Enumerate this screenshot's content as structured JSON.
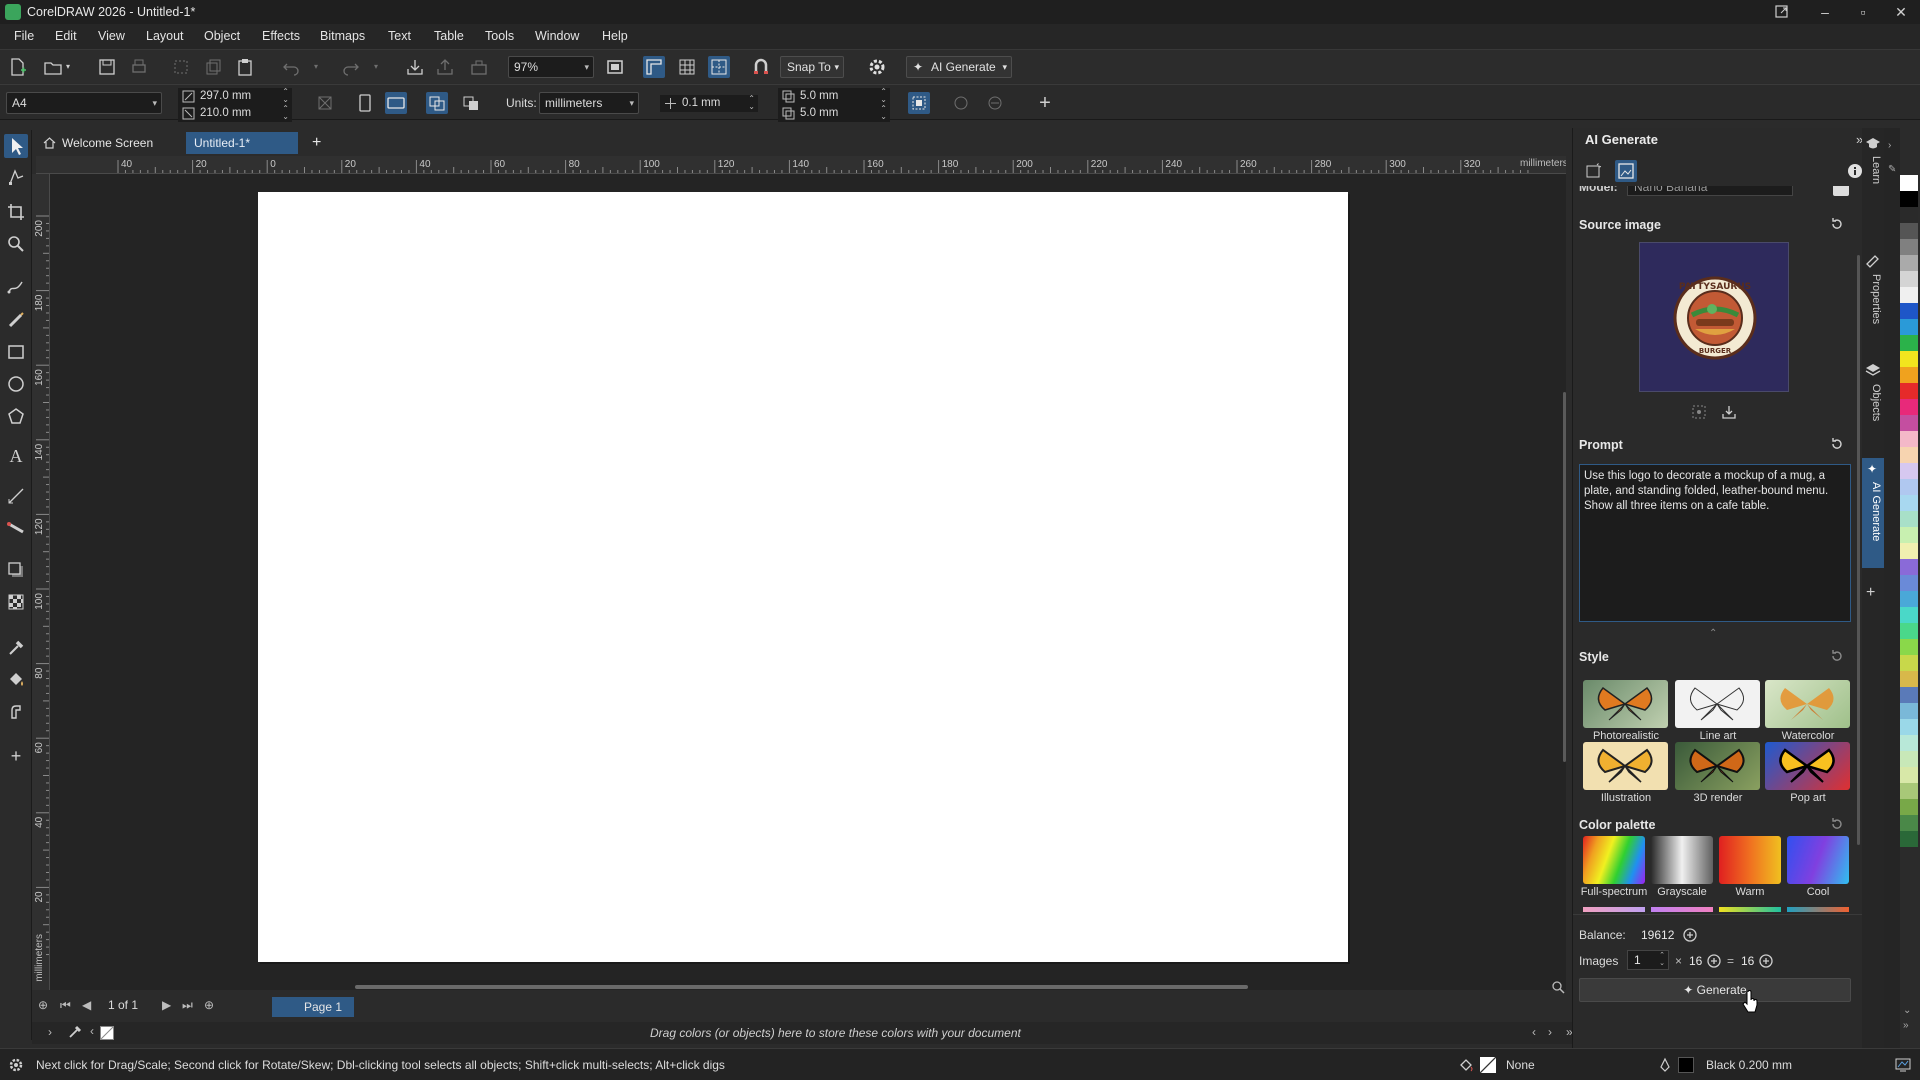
{
  "app": {
    "title": "CorelDRAW 2026 - Untitled-1*",
    "window_controls": [
      "minimize",
      "restore",
      "close"
    ]
  },
  "menu": [
    "File",
    "Edit",
    "View",
    "Layout",
    "Object",
    "Effects",
    "Bitmaps",
    "Text",
    "Table",
    "Tools",
    "Window",
    "Help"
  ],
  "toolbar": {
    "zoom": "97%",
    "snap_to": "Snap To",
    "ai_generate": "AI Generate"
  },
  "property_bar": {
    "page_size": "A4",
    "width": "297.0 mm",
    "height": "210.0 mm",
    "units_label": "Units:",
    "units": "millimeters",
    "nudge": "0.1 mm",
    "dup_x": "5.0 mm",
    "dup_y": "5.0 mm"
  },
  "tabs": {
    "welcome": "Welcome Screen",
    "doc": "Untitled-1*"
  },
  "rulers": {
    "h_labels": [
      "40",
      "20",
      "0",
      "20",
      "40",
      "60",
      "80",
      "100",
      "120",
      "140",
      "160",
      "180",
      "200",
      "220",
      "240",
      "260",
      "280",
      "300",
      "320"
    ],
    "h_units": "millimeters",
    "v_labels": [
      "200",
      "180",
      "160",
      "140",
      "120",
      "100",
      "80",
      "60",
      "40",
      "20"
    ],
    "v_units": "millimeters"
  },
  "page_nav": {
    "counter": "1 of 1",
    "page_tab": "Page 1"
  },
  "color_bar": {
    "hint": "Drag colors (or objects) here to store these colors with your document"
  },
  "status": {
    "message": "Next click for Drag/Scale; Second click for Rotate/Skew; Dbl-clicking tool selects all objects; Shift+click multi-selects; Alt+click digs",
    "fill": "None",
    "outline": "Black 0.200 mm"
  },
  "ai_panel": {
    "title": "AI Generate",
    "model_label": "Model:",
    "model_value": "Nano Banana",
    "source_image_title": "Source image",
    "logo_text_top": "PATTYSAURUS",
    "logo_text_bottom": "BURGER",
    "prompt_title": "Prompt",
    "prompt_text": "Use this logo to decorate a mockup of a mug, a plate, and standing folded, leather-bound menu. Show all three items on a cafe table.",
    "style_title": "Style",
    "styles": [
      "Photorealistic",
      "Line art",
      "Watercolor",
      "Illustration",
      "3D render",
      "Pop art"
    ],
    "palette_title": "Color palette",
    "palettes": [
      "Full-spectrum",
      "Grayscale",
      "Warm",
      "Cool"
    ],
    "balance_label": "Balance:",
    "balance_value": "19612",
    "images_label": "Images",
    "images_value": "1",
    "size_a": "16",
    "size_b": "16",
    "generate": "Generate"
  },
  "docker_tabs": [
    "Learn",
    "Properties",
    "Objects",
    "AI Generate"
  ],
  "colors": {
    "accent": "#2f5a86",
    "page": "#ffffff",
    "canvas": "#242424"
  }
}
